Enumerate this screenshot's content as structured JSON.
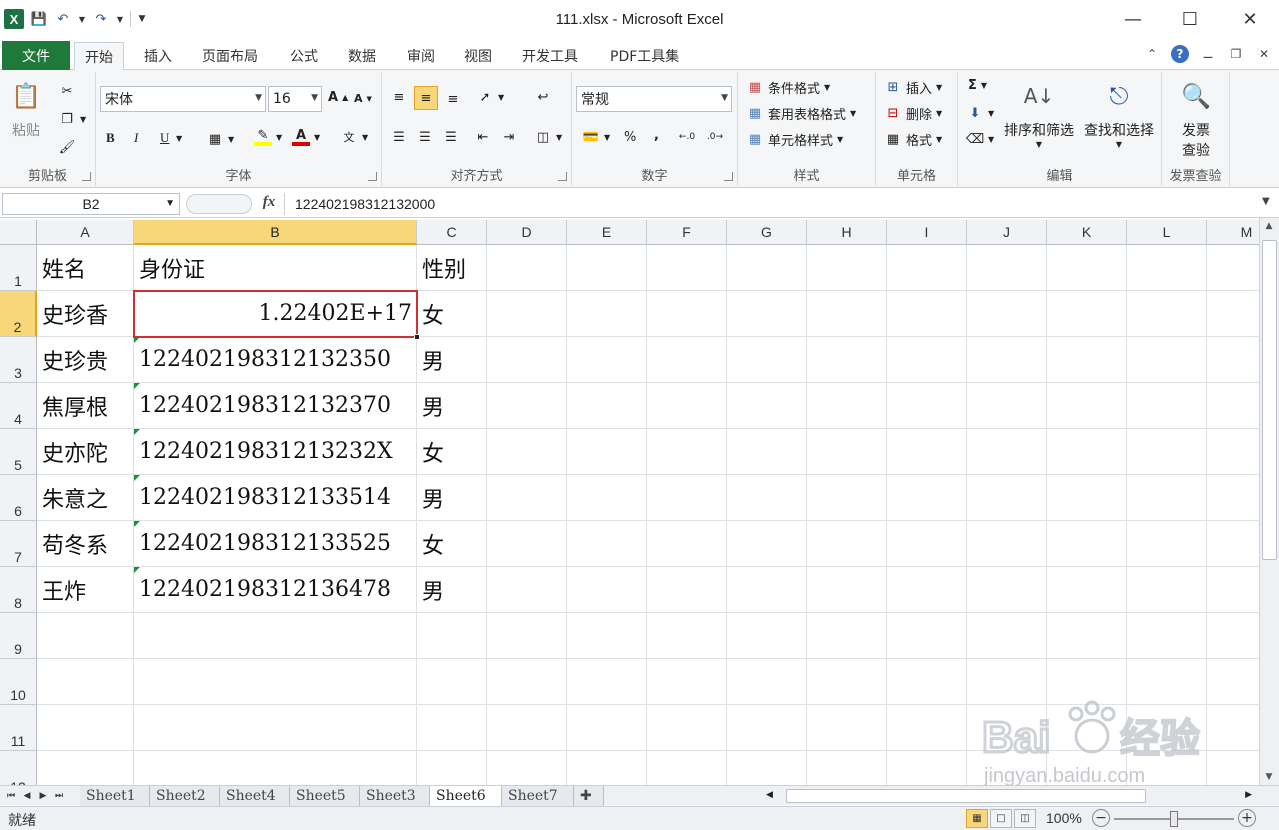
{
  "window": {
    "title": "111.xlsx - Microsoft Excel"
  },
  "tabs": [
    {
      "label": "文件"
    },
    {
      "label": "开始"
    },
    {
      "label": "插入"
    },
    {
      "label": "页面布局"
    },
    {
      "label": "公式"
    },
    {
      "label": "数据"
    },
    {
      "label": "审阅"
    },
    {
      "label": "视图"
    },
    {
      "label": "开发工具"
    },
    {
      "label": "PDF工具集"
    }
  ],
  "ribbon": {
    "clipboard": {
      "label": "剪贴板",
      "paste": "粘贴"
    },
    "font": {
      "label": "字体",
      "name": "宋体",
      "size": "16",
      "bold": "B",
      "italic": "I",
      "underline": "U"
    },
    "alignment": {
      "label": "对齐方式"
    },
    "number": {
      "label": "数字",
      "format": "常规",
      "percent": "%",
      "comma": ","
    },
    "styles": {
      "label": "样式",
      "conditional": "条件格式",
      "table": "套用表格格式",
      "cell": "单元格样式"
    },
    "cells": {
      "label": "单元格",
      "insert": "插入",
      "delete": "删除",
      "format": "格式"
    },
    "editing": {
      "label": "编辑",
      "sum": "Σ",
      "sort": "排序和筛选",
      "find": "查找和选择"
    },
    "invoice": {
      "label": "发票查验",
      "btn1": "发票",
      "btn2": "查验"
    }
  },
  "formula_bar": {
    "name_box": "B2",
    "fx": "fx",
    "value": "122402198312132000"
  },
  "columns": [
    "A",
    "B",
    "C",
    "D",
    "E",
    "F",
    "G",
    "H",
    "I",
    "J",
    "K",
    "L",
    "M"
  ],
  "rows": [
    {
      "num": "1",
      "a": "姓名",
      "b": "身份证",
      "c": "性别"
    },
    {
      "num": "2",
      "a": "史珍香",
      "b": "1.22402E+17",
      "c": "女"
    },
    {
      "num": "3",
      "a": "史珍贵",
      "b": "122402198312132350",
      "c": "男"
    },
    {
      "num": "4",
      "a": "焦厚根",
      "b": "122402198312132370",
      "c": "男"
    },
    {
      "num": "5",
      "a": "史亦陀",
      "b": "12240219831213232X",
      "c": "女"
    },
    {
      "num": "6",
      "a": "朱意之",
      "b": "122402198312133514",
      "c": "男"
    },
    {
      "num": "7",
      "a": "苟冬系",
      "b": "122402198312133525",
      "c": "女"
    },
    {
      "num": "8",
      "a": "王炸",
      "b": "122402198312136478",
      "c": "男"
    },
    {
      "num": "9",
      "a": "",
      "b": "",
      "c": ""
    },
    {
      "num": "10",
      "a": "",
      "b": "",
      "c": ""
    },
    {
      "num": "11",
      "a": "",
      "b": "",
      "c": ""
    },
    {
      "num": "12",
      "a": "",
      "b": "",
      "c": ""
    }
  ],
  "sheets": [
    "Sheet1",
    "Sheet2",
    "Sheet4",
    "Sheet5",
    "Sheet3",
    "Sheet6",
    "Sheet7"
  ],
  "active_sheet": "Sheet6",
  "status": {
    "ready": "就绪",
    "zoom": "100%"
  },
  "watermark": {
    "line1": "Bai",
    "line2": "经验",
    "url": "jingyan.baidu.com"
  },
  "colors": {
    "selection": "#d12f2f",
    "header_selected": "#f8d67a",
    "file_tab": "#1f7a3a"
  }
}
